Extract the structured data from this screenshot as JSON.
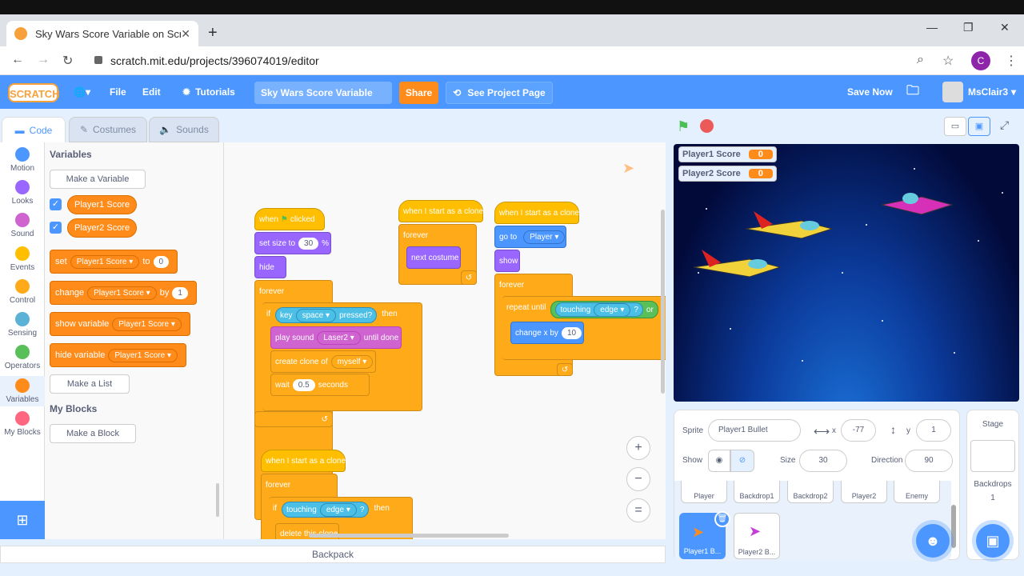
{
  "browser": {
    "tab_title": "Sky Wars Score Variable on Scratc",
    "url": "scratch.mit.edu/projects/396074019/editor",
    "profile_initial": "C"
  },
  "menu": {
    "logo": "SCRATCH",
    "file": "File",
    "edit": "Edit",
    "tutorials": "Tutorials",
    "project_title": "Sky Wars Score Variable",
    "share": "Share",
    "see_project_page": "See Project Page",
    "save_now": "Save Now",
    "username": "MsClair3"
  },
  "editor_tabs": {
    "code": "Code",
    "costumes": "Costumes",
    "sounds": "Sounds"
  },
  "categories": [
    {
      "label": "Motion",
      "color": "#4c97ff"
    },
    {
      "label": "Looks",
      "color": "#9966ff"
    },
    {
      "label": "Sound",
      "color": "#cf63cf"
    },
    {
      "label": "Events",
      "color": "#ffbf00"
    },
    {
      "label": "Control",
      "color": "#ffab19"
    },
    {
      "label": "Sensing",
      "color": "#5cb1d6"
    },
    {
      "label": "Operators",
      "color": "#59c059"
    },
    {
      "label": "Variables",
      "color": "#ff8c1a"
    },
    {
      "label": "My Blocks",
      "color": "#ff6680"
    }
  ],
  "palette": {
    "heading": "Variables",
    "make_variable": "Make a Variable",
    "var1": "Player1 Score",
    "var2": "Player2 Score",
    "set": "set",
    "set_var": "Player1 Score",
    "to": "to",
    "set_val": "0",
    "change": "change",
    "change_var": "Player1 Score",
    "by": "by",
    "change_val": "1",
    "show_variable": "show variable",
    "show_var": "Player1 Score",
    "hide_variable": "hide variable",
    "hide_var": "Player1 Score",
    "make_list": "Make a List",
    "my_blocks_heading": "My Blocks",
    "make_block": "Make a Block"
  },
  "scripts": {
    "s1_hat": "when",
    "s1_clicked": "clicked",
    "s1_setsize": "set size to",
    "s1_setsize_val": "30",
    "s1_pct": "%",
    "s1_hide": "hide",
    "s1_forever": "forever",
    "s1_if": "if",
    "s1_key": "key",
    "s1_space": "space",
    "s1_pressed": "pressed?",
    "s1_then": "then",
    "s1_playsound": "play sound",
    "s1_laser": "Laser2",
    "s1_untildone": "until done",
    "s1_createclone": "create clone of",
    "s1_myself": "myself",
    "s1_wait": "wait",
    "s1_wait_val": "0.5",
    "s1_seconds": "seconds",
    "s2_hat": "when I start as a clone",
    "s2_forever": "forever",
    "s2_nextcostume": "next costume",
    "s3_hat": "when I start as a clone",
    "s3_goto": "go to",
    "s3_player": "Player",
    "s3_show": "show",
    "s3_forever": "forever",
    "s3_repeatuntil": "repeat until",
    "s3_touching": "touching",
    "s3_edge": "edge",
    "s3_q": "?",
    "s3_or": "or",
    "s3_changex": "change x by",
    "s3_changex_val": "10",
    "s4_hat": "when I start as a clone",
    "s4_forever": "forever",
    "s4_if": "if",
    "s4_touching": "touching",
    "s4_edge": "edge",
    "s4_q": "?",
    "s4_then": "then",
    "s4_delete": "delete this clone"
  },
  "zoom": {
    "in": "+",
    "out": "−",
    "reset": "="
  },
  "backpack": "Backpack",
  "stage_monitors": [
    {
      "label": "Player1 Score",
      "value": "0"
    },
    {
      "label": "Player2 Score",
      "value": "0"
    }
  ],
  "sprite_info": {
    "sprite_label": "Sprite",
    "sprite_name": "Player1 Bullet",
    "x_label": "x",
    "x_val": "-77",
    "y_label": "y",
    "y_val": "1",
    "show_label": "Show",
    "size_label": "Size",
    "size_val": "30",
    "direction_label": "Direction",
    "direction_val": "90"
  },
  "sprites": [
    "Player",
    "Backdrop1",
    "Backdrop2",
    "Player2",
    "Enemy",
    "Player1 B...",
    "Player2 B..."
  ],
  "stage_panel": {
    "title": "Stage",
    "backdrops_label": "Backdrops",
    "backdrops_count": "1"
  }
}
